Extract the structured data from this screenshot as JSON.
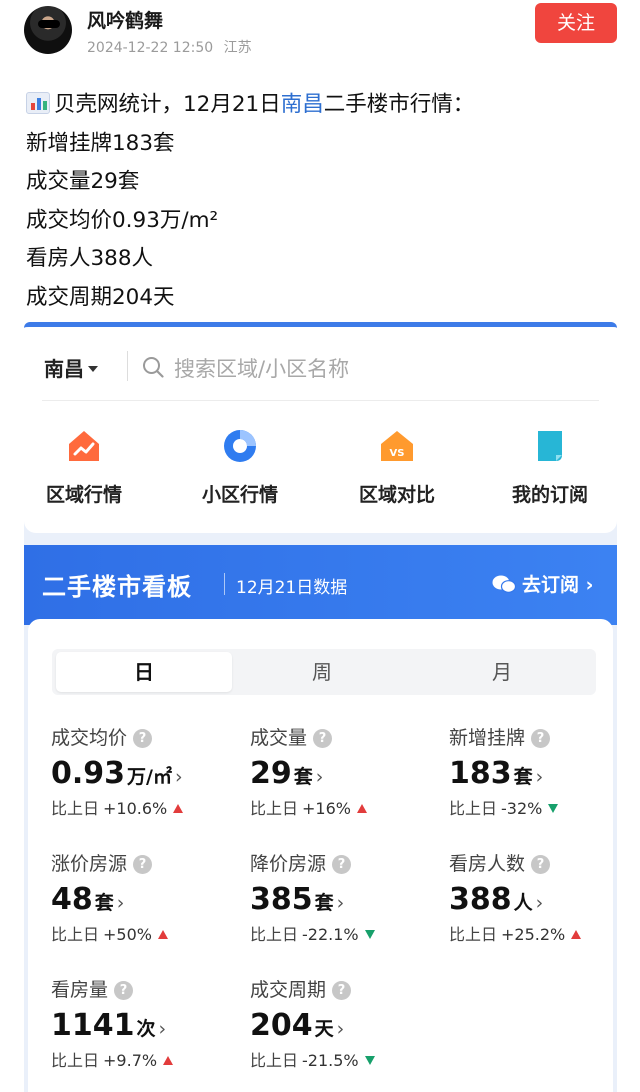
{
  "post": {
    "author": "风吟鹤舞",
    "timestamp": "2024-12-22 12:50",
    "location": "江苏",
    "follow_label": "关注",
    "intro_prefix": "贝壳网统计，12月21日",
    "intro_city": "南昌",
    "intro_suffix": "二手楼市行情：",
    "lines": [
      "新增挂牌183套",
      "成交量29套",
      "成交均价0.93万/m²",
      "看房人388人",
      "成交周期204天"
    ]
  },
  "app": {
    "city": "南昌",
    "search_placeholder": "搜索区域/小区名称",
    "quick_nav": [
      {
        "label": "区域行情",
        "icon": "house-trend-icon"
      },
      {
        "label": "小区行情",
        "icon": "pie-chart-icon"
      },
      {
        "label": "区域对比",
        "icon": "vs-compare-icon"
      },
      {
        "label": "我的订阅",
        "icon": "bookmark-icon"
      }
    ],
    "board": {
      "title": "二手楼市看板",
      "date": "12月21日数据",
      "subscribe": "去订阅 ›"
    },
    "tabs": [
      "日",
      "周",
      "月"
    ],
    "active_tab": "日",
    "compare_prefix": "比上日",
    "metrics": [
      {
        "label": "成交均价",
        "value": "0.93",
        "unit": "万/㎡",
        "change": "+10.6%",
        "trend": "up"
      },
      {
        "label": "成交量",
        "value": "29",
        "unit": "套",
        "change": "+16%",
        "trend": "up"
      },
      {
        "label": "新增挂牌",
        "value": "183",
        "unit": "套",
        "change": "-32%",
        "trend": "down"
      },
      {
        "label": "涨价房源",
        "value": "48",
        "unit": "套",
        "change": "+50%",
        "trend": "up"
      },
      {
        "label": "降价房源",
        "value": "385",
        "unit": "套",
        "change": "-22.1%",
        "trend": "down"
      },
      {
        "label": "看房人数",
        "value": "388",
        "unit": "人",
        "change": "+25.2%",
        "trend": "up"
      },
      {
        "label": "看房量",
        "value": "1141",
        "unit": "次",
        "change": "+9.7%",
        "trend": "up"
      },
      {
        "label": "成交周期",
        "value": "204",
        "unit": "天",
        "change": "-21.5%",
        "trend": "down"
      }
    ]
  },
  "colors": {
    "follow": "#f0453e",
    "link": "#2e6fd0",
    "board_blue": "#2f6fe6",
    "up": "#e23c3c",
    "down": "#17a06b"
  }
}
